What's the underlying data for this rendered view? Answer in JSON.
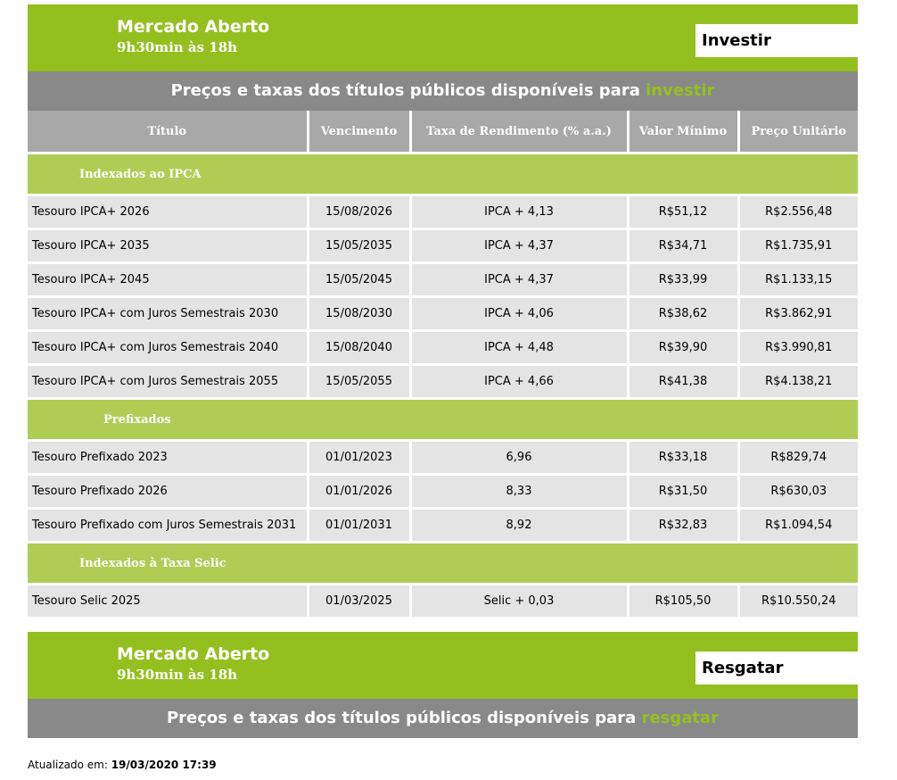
{
  "invest_section": {
    "market_title": "Mercado Aberto",
    "market_hours": "9h30min às 18h",
    "action_tab": "Investir",
    "header_prefix": "Preços e taxas dos títulos públicos disponíveis para",
    "header_accent": "investir"
  },
  "table": {
    "columns": [
      "Título",
      "Vencimento",
      "Taxa de Rendimento (% a.a.)",
      "Valor Mínimo",
      "Preço Unitário"
    ],
    "groups": [
      {
        "label": "Indexados ao IPCA",
        "rows": [
          {
            "title": "Tesouro IPCA+ 2026",
            "maturity": "15/08/2026",
            "rate": "IPCA + 4,13",
            "min_value": "R$51,12",
            "unit_price": "R$2.556,48"
          },
          {
            "title": "Tesouro IPCA+ 2035",
            "maturity": "15/05/2035",
            "rate": "IPCA + 4,37",
            "min_value": "R$34,71",
            "unit_price": "R$1.735,91"
          },
          {
            "title": "Tesouro IPCA+ 2045",
            "maturity": "15/05/2045",
            "rate": "IPCA + 4,37",
            "min_value": "R$33,99",
            "unit_price": "R$1.133,15"
          },
          {
            "title": "Tesouro IPCA+ com Juros Semestrais 2030",
            "maturity": "15/08/2030",
            "rate": "IPCA + 4,06",
            "min_value": "R$38,62",
            "unit_price": "R$3.862,91"
          },
          {
            "title": "Tesouro IPCA+ com Juros Semestrais 2040",
            "maturity": "15/08/2040",
            "rate": "IPCA + 4,48",
            "min_value": "R$39,90",
            "unit_price": "R$3.990,81"
          },
          {
            "title": "Tesouro IPCA+ com Juros Semestrais 2055",
            "maturity": "15/05/2055",
            "rate": "IPCA + 4,66",
            "min_value": "R$41,38",
            "unit_price": "R$4.138,21"
          }
        ]
      },
      {
        "label": "Prefixados",
        "rows": [
          {
            "title": "Tesouro Prefixado 2023",
            "maturity": "01/01/2023",
            "rate": "6,96",
            "min_value": "R$33,18",
            "unit_price": "R$829,74"
          },
          {
            "title": "Tesouro Prefixado 2026",
            "maturity": "01/01/2026",
            "rate": "8,33",
            "min_value": "R$31,50",
            "unit_price": "R$630,03"
          },
          {
            "title": "Tesouro Prefixado com Juros Semestrais 2031",
            "maturity": "01/01/2031",
            "rate": "8,92",
            "min_value": "R$32,83",
            "unit_price": "R$1.094,54"
          }
        ]
      },
      {
        "label": "Indexados à Taxa Selic",
        "rows": [
          {
            "title": "Tesouro Selic 2025",
            "maturity": "01/03/2025",
            "rate": "Selic + 0,03",
            "min_value": "R$105,50",
            "unit_price": "R$10.550,24"
          }
        ]
      }
    ]
  },
  "redeem_section": {
    "market_title": "Mercado Aberto",
    "market_hours": "9h30min às 18h",
    "action_tab": "Resgatar",
    "header_prefix": "Preços e taxas dos títulos públicos disponíveis para",
    "header_accent": "resgatar"
  },
  "footer": {
    "updated_label": "Atualizado em:",
    "updated_value": "19/03/2020 17:39"
  },
  "colors": {
    "green": "#93c01f",
    "light_green": "#afcd55",
    "dark_gray": "#898989",
    "header_gray": "#a8a8a8",
    "row_gray": "#e4e4e4"
  }
}
